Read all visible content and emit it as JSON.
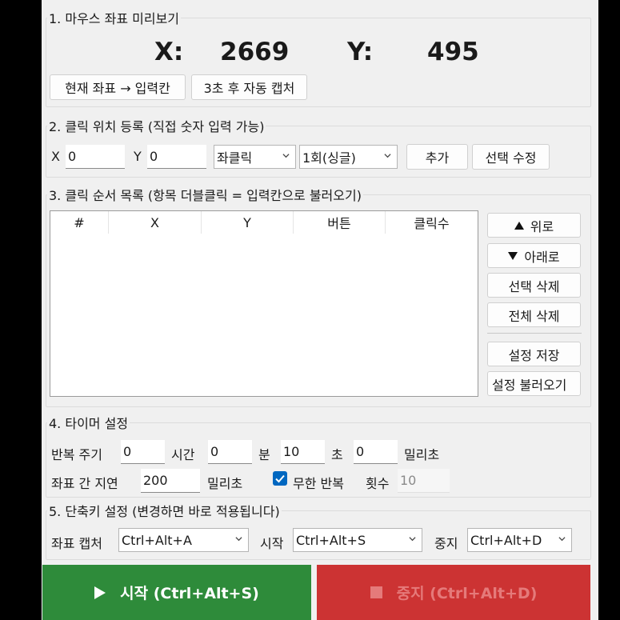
{
  "preview": {
    "legend": "1. 마우스 좌표 미리보기",
    "x_label": "X:",
    "x_value": "2669",
    "y_label": "Y:",
    "y_value": "495",
    "btn_current": "현재 좌표 → 입력칸",
    "btn_capture": "3초 후 자동 캡처"
  },
  "register": {
    "legend": "2. 클릭 위치 등록  (직접 숫자 입력 가능)",
    "x_label": "X",
    "x_value": "0",
    "y_label": "Y",
    "y_value": "0",
    "button_select": "좌클릭",
    "count_select": "1회(싱글)",
    "btn_add": "추가",
    "btn_edit": "선택 수정"
  },
  "sequence": {
    "legend": "3. 클릭 순서 목록  (항목 더블클릭 = 입력칸으로 불러오기)",
    "columns": [
      "#",
      "X",
      "Y",
      "버튼",
      "클릭수"
    ],
    "btn_up": "위로",
    "btn_down": "아래로",
    "btn_delete_sel": "선택 삭제",
    "btn_delete_all": "전체 삭제",
    "btn_save": "설정 저장",
    "btn_load": "설정 불러오기"
  },
  "timer": {
    "legend": "4. 타이머 설정",
    "repeat_label": "반복 주기",
    "hours_value": "0",
    "hours_label": "시간",
    "min_value": "0",
    "min_label": "분",
    "sec_value": "10",
    "sec_label": "초",
    "ms_value": "0",
    "ms_label": "밀리초",
    "delay_label": "좌표 간 지연",
    "delay_value": "200",
    "delay_unit": "밀리초",
    "infinite_label": "무한 반복",
    "infinite_checked": true,
    "count_label": "횟수",
    "count_value": "10"
  },
  "hotkeys": {
    "legend": "5. 단축키 설정  (변경하면 바로 적용됩니다)",
    "capture_label": "좌표 캡처",
    "capture_value": "Ctrl+Alt+A",
    "start_label": "시작",
    "start_value": "Ctrl+Alt+S",
    "stop_label": "중지",
    "stop_value": "Ctrl+Alt+D"
  },
  "actions": {
    "start_label": "시작  (Ctrl+Alt+S)",
    "stop_label": "중지  (Ctrl+Alt+D)",
    "start_color": "#2e8b3a",
    "stop_color": "#cc3333",
    "accent_color": "#0067c0"
  }
}
